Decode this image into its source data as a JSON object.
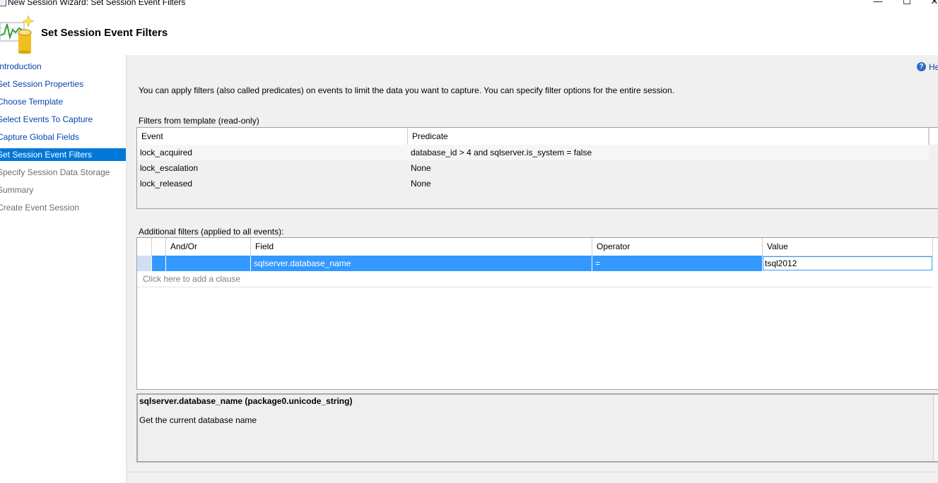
{
  "window": {
    "title": "New Session Wizard: Set Session Event Filters",
    "minimize_glyph": "—",
    "maximize_glyph": "☐",
    "close_glyph": "✕"
  },
  "header": {
    "title": "Set Session Event Filters",
    "logo_icon": "chart-database-icon"
  },
  "sidebar": {
    "items": [
      {
        "label": "Introduction",
        "state": "link"
      },
      {
        "label": "Set Session Properties",
        "state": "link"
      },
      {
        "label": "Choose Template",
        "state": "link"
      },
      {
        "label": "Select Events To Capture",
        "state": "link"
      },
      {
        "label": "Capture Global Fields",
        "state": "link"
      },
      {
        "label": "Set Session Event Filters",
        "state": "selected"
      },
      {
        "label": "Specify Session Data Storage",
        "state": "disabled"
      },
      {
        "label": "Summary",
        "state": "disabled"
      },
      {
        "label": "Create Event Session",
        "state": "disabled"
      }
    ]
  },
  "help": {
    "label": "He",
    "icon": "help-icon",
    "glyph": "?"
  },
  "intro_text": "You can apply filters (also called predicates) on events to limit the data you want to capture. You can specify filter options for the entire session.",
  "template_filters": {
    "label": "Filters from template (read-only)",
    "columns": [
      "Event",
      "Predicate"
    ],
    "rows": [
      {
        "event": "lock_acquired",
        "predicate": "database_id > 4 and sqlserver.is_system = false"
      },
      {
        "event": "lock_escalation",
        "predicate": "None"
      },
      {
        "event": "lock_released",
        "predicate": "None"
      }
    ]
  },
  "additional_filters": {
    "label": "Additional filters (applied to all events):",
    "columns": [
      "And/Or",
      "Field",
      "Operator",
      "Value"
    ],
    "rows": [
      {
        "and_or": "",
        "field": "sqlserver.database_name",
        "operator": "=",
        "value": "tsql2012"
      }
    ],
    "add_clause": "Click here to add a clause"
  },
  "description": {
    "title": "sqlserver.database_name (package0.unicode_string)",
    "text": "Get the current database name"
  },
  "colors": {
    "selected_bg": "#0078d7",
    "row_highlight": "#3399ff",
    "link": "#0645ad",
    "panel_bg": "#f0f0f0"
  }
}
